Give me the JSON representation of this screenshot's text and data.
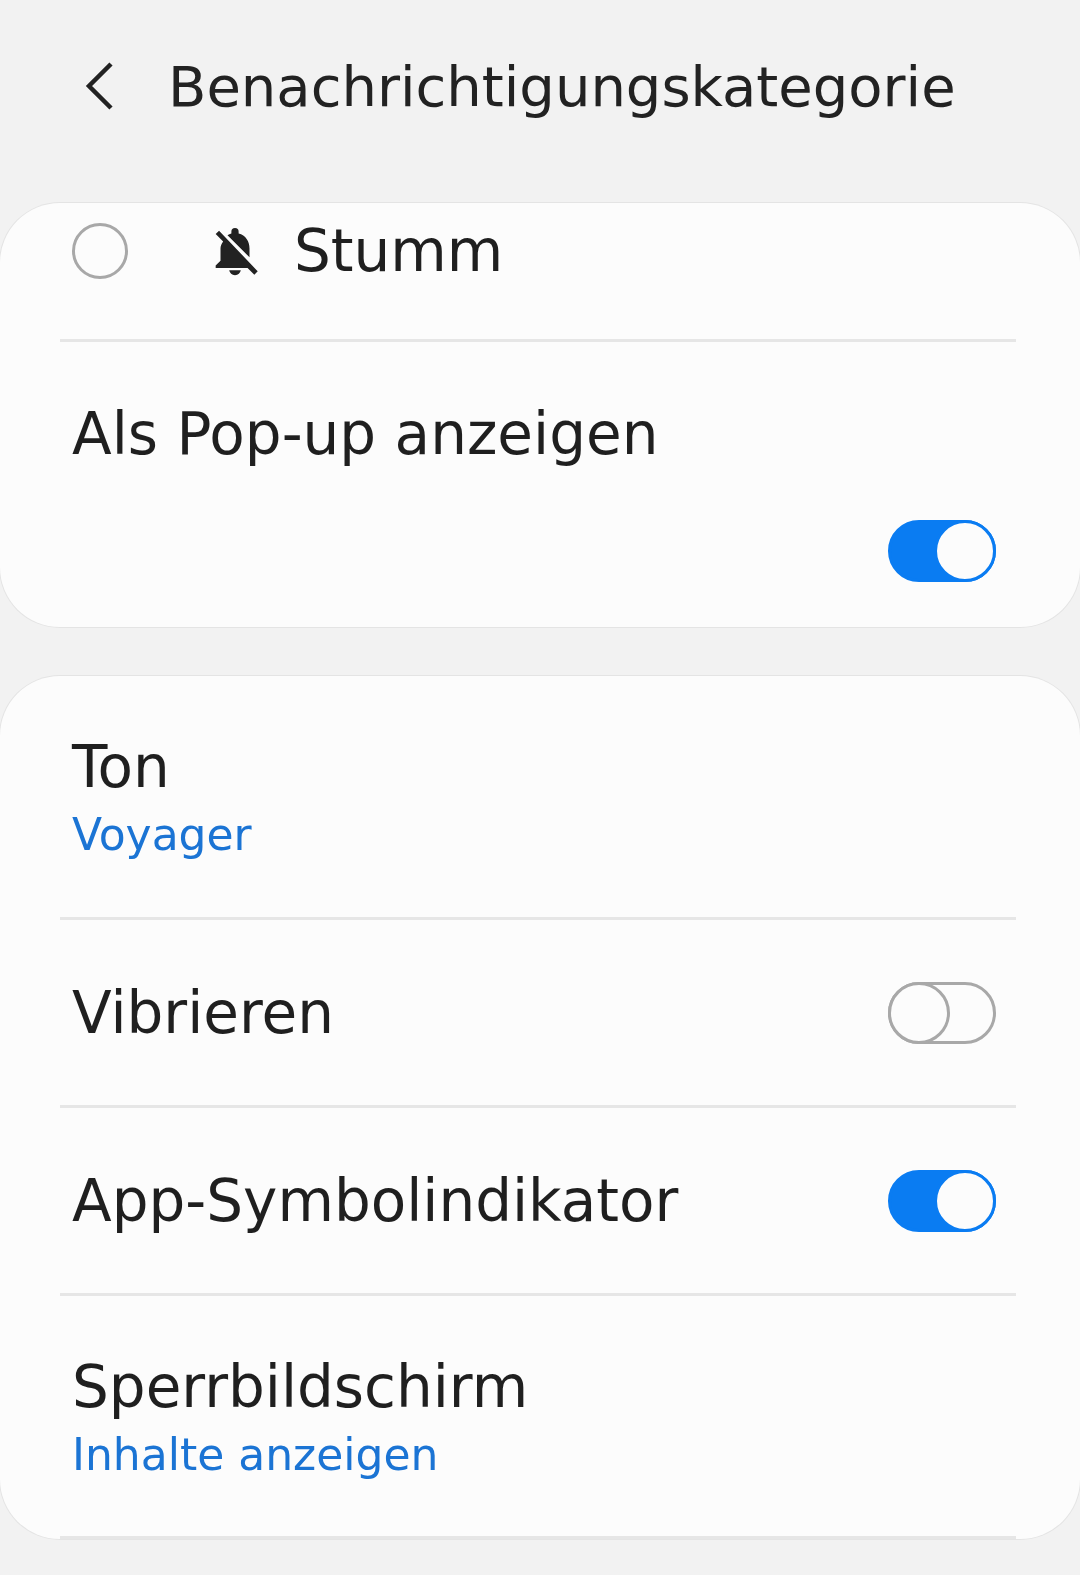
{
  "header": {
    "title": "Benachrichtigungskategorie"
  },
  "cards": [
    {
      "rows": [
        {
          "kind": "radio",
          "label": "Stumm",
          "selected": false
        },
        {
          "kind": "toggle_below",
          "label": "Als Pop-up anzeigen",
          "on": true
        }
      ]
    },
    {
      "rows": [
        {
          "kind": "link",
          "label": "Ton",
          "value": "Voyager"
        },
        {
          "kind": "toggle",
          "label": "Vibrieren",
          "on": false
        },
        {
          "kind": "toggle",
          "label": "App-Symbolindikator",
          "on": true
        },
        {
          "kind": "link",
          "label": "Sperrbildschirm",
          "value": "Inhalte anzeigen"
        }
      ]
    }
  ]
}
